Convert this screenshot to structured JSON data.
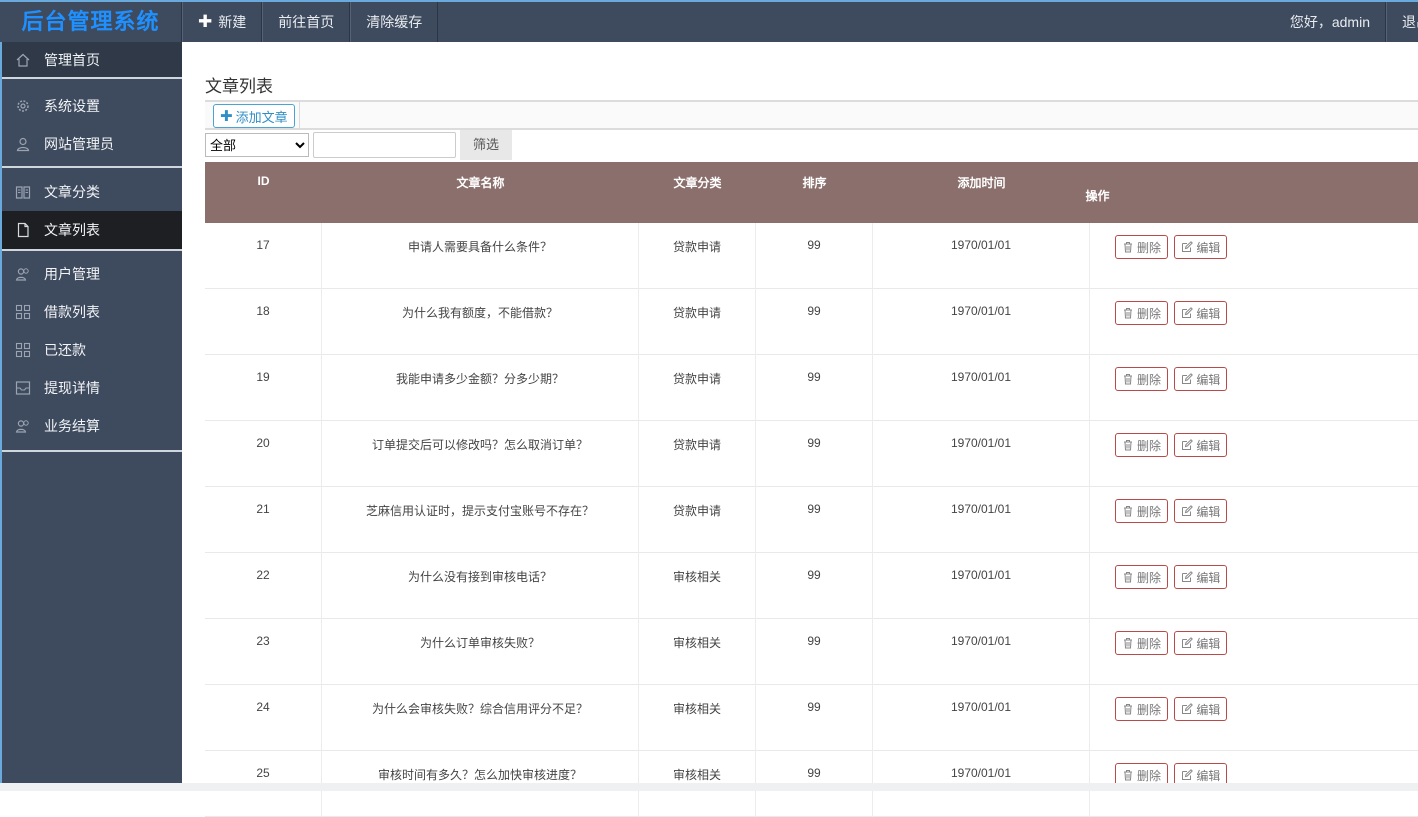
{
  "app": {
    "logo": "后台管理系统"
  },
  "topnav": {
    "new_label": "新建",
    "home_label": "前往首页",
    "clear_cache_label": "清除缓存",
    "greeting": "您好，admin",
    "logout_label": "退出"
  },
  "sidebar": {
    "home": "管理首页",
    "system_settings": "系统设置",
    "site_admins": "网站管理员",
    "article_category": "文章分类",
    "article_list": "文章列表",
    "user_management": "用户管理",
    "loan_list": "借款列表",
    "repaid": "已还款",
    "withdraw_details": "提现详情",
    "business_settlement": "业务结算"
  },
  "page": {
    "title": "文章列表",
    "add_button": "添加文章",
    "filter_select_value": "全部",
    "filter_input_value": "",
    "filter_button": "筛选"
  },
  "table": {
    "headers": {
      "id": "ID",
      "name": "文章名称",
      "category": "文章分类",
      "sort": "排序",
      "time": "添加时间",
      "op": "操作"
    },
    "delete_label": "删除",
    "edit_label": "编辑",
    "rows": [
      {
        "id": "17",
        "name": "申请人需要具备什么条件？",
        "category": "贷款申请",
        "sort": "99",
        "time": "1970/01/01"
      },
      {
        "id": "18",
        "name": "为什么我有额度，不能借款？",
        "category": "贷款申请",
        "sort": "99",
        "time": "1970/01/01"
      },
      {
        "id": "19",
        "name": "我能申请多少金额？分多少期？",
        "category": "贷款申请",
        "sort": "99",
        "time": "1970/01/01"
      },
      {
        "id": "20",
        "name": "订单提交后可以修改吗？怎么取消订单？",
        "category": "贷款申请",
        "sort": "99",
        "time": "1970/01/01"
      },
      {
        "id": "21",
        "name": "芝麻信用认证时，提示支付宝账号不存在？",
        "category": "贷款申请",
        "sort": "99",
        "time": "1970/01/01"
      },
      {
        "id": "22",
        "name": "为什么没有接到审核电话？",
        "category": "审核相关",
        "sort": "99",
        "time": "1970/01/01"
      },
      {
        "id": "23",
        "name": "为什么订单审核失败？",
        "category": "审核相关",
        "sort": "99",
        "time": "1970/01/01"
      },
      {
        "id": "24",
        "name": "为什么会审核失败？综合信用评分不足？",
        "category": "审核相关",
        "sort": "99",
        "time": "1970/01/01"
      },
      {
        "id": "25",
        "name": "审核时间有多久？怎么加快审核进度？",
        "category": "审核相关",
        "sort": "99",
        "time": "1970/01/01"
      }
    ]
  },
  "colors": {
    "topbar_bg": "#3e4a5d",
    "logo": "#1e90ff",
    "table_header_bg": "#8b6f6c",
    "op_button_border": "#b94a48",
    "sidebar_active": "#1d1f22"
  }
}
